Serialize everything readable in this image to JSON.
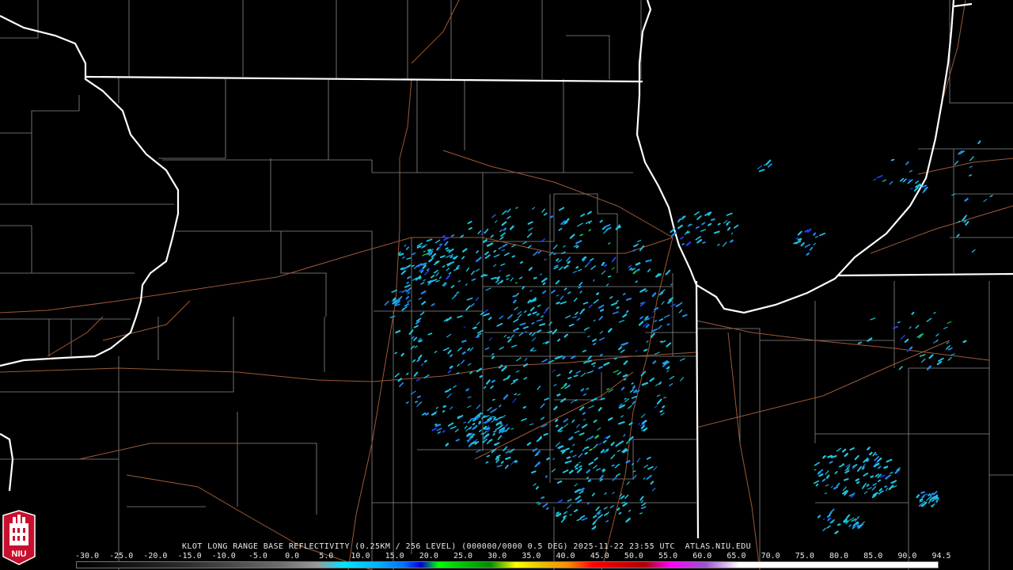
{
  "product": {
    "caption": "KLOT LONG RANGE BASE REFLECTIVITY (0.25KM / 256 LEVEL) (000000/0000 0.5 DEG) 2025-11-22 23:55 UTC  ATLAS.NIU.EDU"
  },
  "scale": {
    "labels": [
      "-30.0",
      "-25.0",
      "-20.0",
      "-15.0",
      "-10.0",
      "-5.0",
      "0.0",
      "5.0",
      "10.0",
      "15.0",
      "20.0",
      "25.0",
      "30.0",
      "35.0",
      "40.0",
      "45.0",
      "50.0",
      "55.0",
      "60.0",
      "65.0",
      "70.0",
      "75.0",
      "80.0",
      "85.0",
      "90.0",
      "94.5"
    ]
  },
  "logo": {
    "text": "NIU",
    "icon": "university-seal-icon"
  },
  "colors": {
    "background": "#000000",
    "state_lines": "#ffffff",
    "county_lines": "#8a8a8a",
    "highways": "#9c5a36",
    "echo_light": "#1fc4e0",
    "echo_mid": "#1f8cf0",
    "echo_dark": "#1f3cf0",
    "echo_green": "#18c840",
    "logo_red": "#c8102e"
  }
}
